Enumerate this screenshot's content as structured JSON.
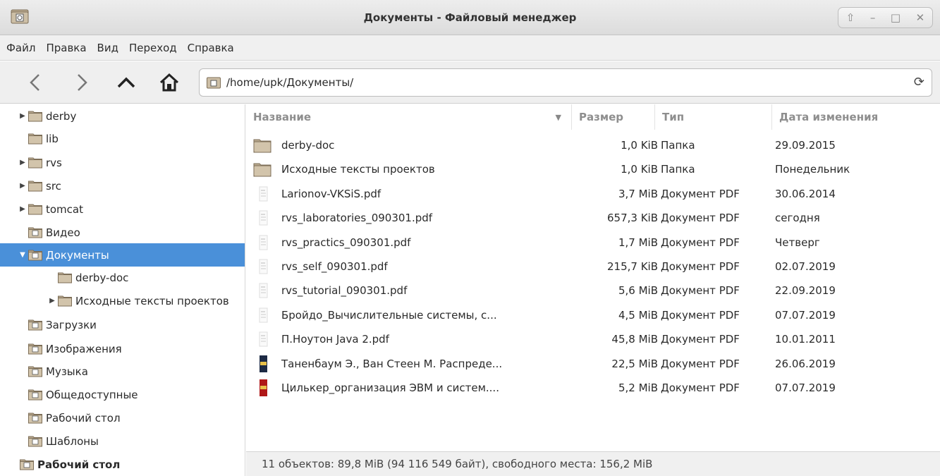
{
  "window": {
    "title": "Документы - Файловый менеджер"
  },
  "menu": [
    "Файл",
    "Правка",
    "Вид",
    "Переход",
    "Справка"
  ],
  "address": {
    "path": "/home/upk/Документы/"
  },
  "sidebar": [
    {
      "label": "derby",
      "expander": "▶",
      "icon": "folder"
    },
    {
      "label": "lib",
      "expander": "",
      "icon": "folder"
    },
    {
      "label": "rvs",
      "expander": "▶",
      "icon": "folder"
    },
    {
      "label": "src",
      "expander": "▶",
      "icon": "folder"
    },
    {
      "label": "tomcat",
      "expander": "▶",
      "icon": "folder"
    },
    {
      "label": "Видео",
      "expander": "",
      "icon": "folder-video"
    },
    {
      "label": "Документы",
      "expander": "▼",
      "icon": "folder-documents",
      "selected": true
    },
    {
      "label": "derby-doc",
      "expander": "",
      "icon": "folder",
      "indent": 2
    },
    {
      "label": "Исходные тексты проектов",
      "expander": "▶",
      "icon": "folder",
      "indent": 2
    },
    {
      "label": "Загрузки",
      "expander": "",
      "icon": "folder-downloads"
    },
    {
      "label": "Изображения",
      "expander": "",
      "icon": "folder-pictures"
    },
    {
      "label": "Музыка",
      "expander": "",
      "icon": "folder-music"
    },
    {
      "label": "Общедоступные",
      "expander": "",
      "icon": "folder-public"
    },
    {
      "label": "Рабочий стол",
      "expander": "",
      "icon": "folder-desktop"
    },
    {
      "label": "Шаблоны",
      "expander": "",
      "icon": "folder-templates"
    },
    {
      "label": "Рабочий стол",
      "expander": "",
      "icon": "folder-desktop",
      "bold": true,
      "indent": -1
    }
  ],
  "columns": {
    "name": "Название",
    "size": "Размер",
    "type": "Тип",
    "date": "Дата изменения",
    "sort_indicator": "▼"
  },
  "files": [
    {
      "name": "derby-doc",
      "size": "1,0 KiB",
      "type": "Папка",
      "date": "29.09.2015",
      "icon": "folder-icon"
    },
    {
      "name": "Исходные тексты проектов",
      "size": "1,0 KiB",
      "type": "Папка",
      "date": "Понедельник",
      "icon": "folder-icon"
    },
    {
      "name": "Larionov-VKSiS.pdf",
      "size": "3,7 MiB",
      "type": "Документ PDF",
      "date": "30.06.2014",
      "icon": "pdf-thumb-icon"
    },
    {
      "name": "rvs_laboratories_090301.pdf",
      "size": "657,3 KiB",
      "type": "Документ PDF",
      "date": "сегодня",
      "icon": "pdf-thumb-icon"
    },
    {
      "name": "rvs_practics_090301.pdf",
      "size": "1,7 MiB",
      "type": "Документ PDF",
      "date": "Четверг",
      "icon": "pdf-thumb-icon"
    },
    {
      "name": "rvs_self_090301.pdf",
      "size": "215,7 KiB",
      "type": "Документ PDF",
      "date": "02.07.2019",
      "icon": "pdf-thumb-icon"
    },
    {
      "name": "rvs_tutorial_090301.pdf",
      "size": "5,6 MiB",
      "type": "Документ PDF",
      "date": "22.09.2019",
      "icon": "pdf-thumb-icon"
    },
    {
      "name": "Бройдо_Вычислительные системы, с...",
      "size": "4,5 MiB",
      "type": "Документ PDF",
      "date": "07.07.2019",
      "icon": "pdf-thumb-icon"
    },
    {
      "name": "П.Ноутон Java 2.pdf",
      "size": "45,8 MiB",
      "type": "Документ PDF",
      "date": "10.01.2011",
      "icon": "pdf-thumb-icon"
    },
    {
      "name": "Таненбаум Э., Ван Стеен М. Распреде...",
      "size": "22,5 MiB",
      "type": "Документ PDF",
      "date": "26.06.2019",
      "icon": "book-cover-icon"
    },
    {
      "name": "Цилькер_организация ЭВМ и систем....",
      "size": "5,2 MiB",
      "type": "Документ PDF",
      "date": "07.07.2019",
      "icon": "book-cover-icon"
    }
  ],
  "status": {
    "text": "11 объектов: 89,8 MiB (94 116 549 байт), свободного места: 156,2 MiB"
  },
  "colors": {
    "selection": "#4a90d9",
    "folder": "#c9b9a0"
  }
}
